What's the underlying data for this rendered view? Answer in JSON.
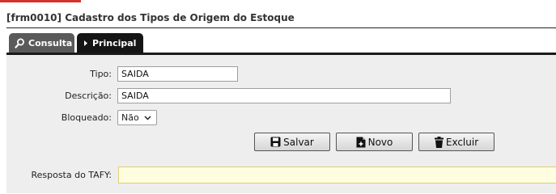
{
  "window": {
    "title": "[frm0010] Cadastro dos Tipos de Origem do Estoque"
  },
  "tabs": [
    {
      "label": "Consulta",
      "icon": "search-icon",
      "active": false
    },
    {
      "label": "Principal",
      "icon": "caret-right-icon",
      "active": true
    }
  ],
  "form": {
    "tipo": {
      "label": "Tipo:",
      "value": "SAIDA"
    },
    "descricao": {
      "label": "Descrição:",
      "value": "SAIDA"
    },
    "bloqueado": {
      "label": "Bloqueado:",
      "value": "Não"
    }
  },
  "buttons": {
    "salvar": {
      "label": "Salvar",
      "icon": "save-icon"
    },
    "novo": {
      "label": "Novo",
      "icon": "new-document-icon"
    },
    "excluir": {
      "label": "Excluir",
      "icon": "trash-icon"
    }
  },
  "resposta": {
    "label": "Resposta do TAFY:",
    "value": ""
  },
  "colors": {
    "accent": "#d2312f",
    "active_tab": "#151515",
    "inactive_tab": "#5a5a5a",
    "panel_bg": "#eeeeee",
    "highlight_field": "#fffde0"
  }
}
